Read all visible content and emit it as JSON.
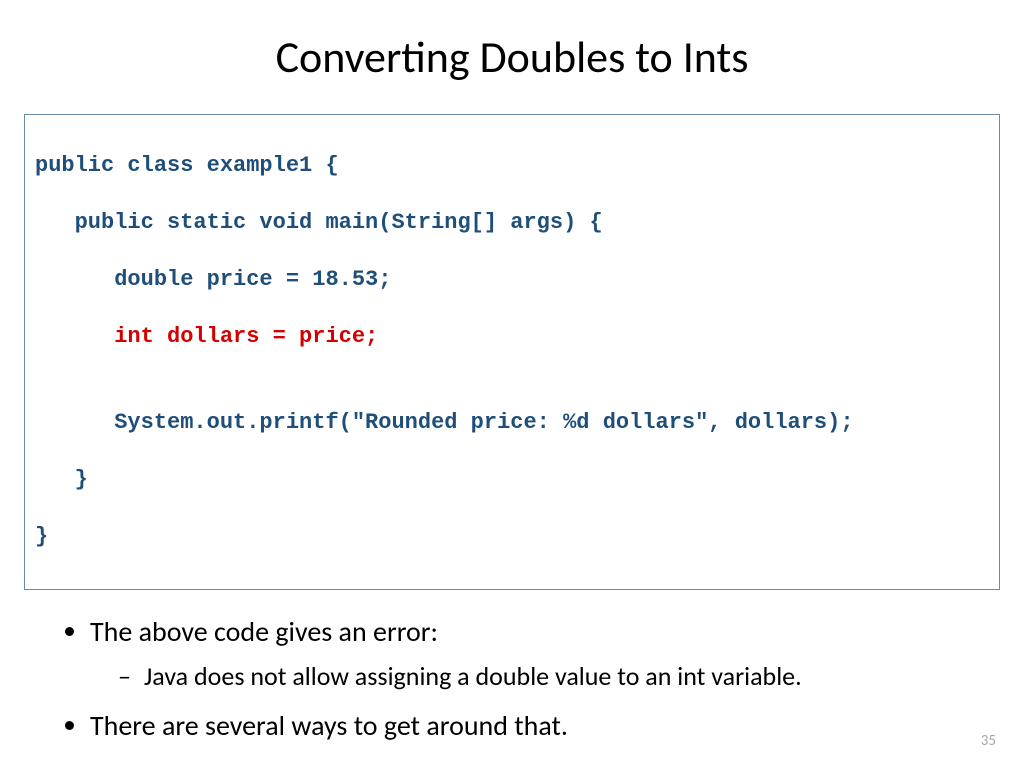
{
  "title": "Converting Doubles to Ints",
  "code": {
    "l1": "public class example1 {",
    "l2": "   public static void main(String[] args) {",
    "l3": "      double price = 18.53;",
    "l4": "      int dollars = price;",
    "l5": "",
    "l6": "      System.out.printf(\"Rounded price: %d dollars\", dollars);",
    "l7": "   }",
    "l8": "}"
  },
  "bullets": {
    "b1": "The above code gives an error:",
    "b1_sub1": "Java does not allow assigning a double value to an int variable.",
    "b2": "There are several ways to get around that."
  },
  "page_number": "35"
}
